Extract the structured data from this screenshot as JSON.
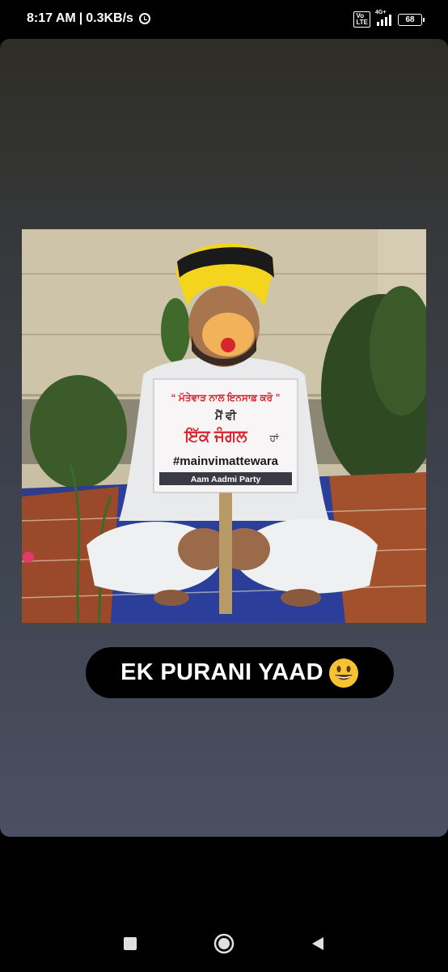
{
  "status_bar": {
    "time": "8:17 AM",
    "separator": "|",
    "speed": "0.3KB/s",
    "alarm_icon": "alarm-icon",
    "volte": "Vo\nLTE",
    "network": "4G+",
    "battery": "68"
  },
  "photo": {
    "placard": {
      "line1": "“ ਮੱਤੇਵਾੜ ਨਾਲ ਇਨਸਾਫ਼ ਕਰੋ ”",
      "line2": "ਮੈਂ ਵੀ",
      "line3_red": "ਇੱਕ ਜੰਗਲ",
      "line3_suffix": "ਹਾਂ",
      "hashtag": "#mainvimattewara",
      "party": "Aam Aadmi Party"
    }
  },
  "caption": {
    "text": "EK PURANI YAAD",
    "emoji": "grinning-face-emoji"
  },
  "nav": {
    "recents": "square-icon",
    "home": "circle-icon",
    "back": "triangle-back-icon"
  },
  "colors": {
    "turban": "#f3d51d",
    "caption_bg": "#000000",
    "accent_red": "#d8262e"
  }
}
